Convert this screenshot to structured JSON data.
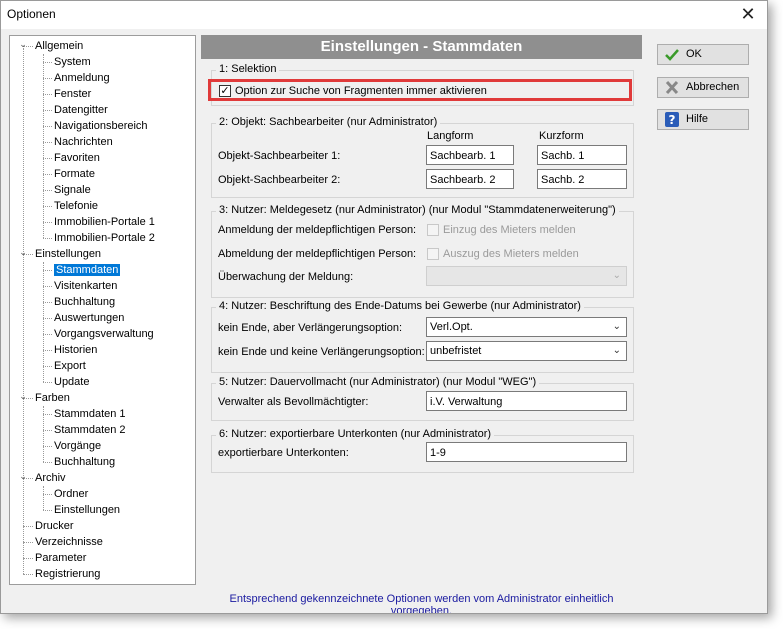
{
  "window": {
    "title": "Optionen",
    "close_glyph": "✕"
  },
  "tree": {
    "nodes": [
      {
        "label": "Allgemein",
        "level": 0,
        "expanded": true
      },
      {
        "label": "System",
        "level": 1
      },
      {
        "label": "Anmeldung",
        "level": 1
      },
      {
        "label": "Fenster",
        "level": 1
      },
      {
        "label": "Datengitter",
        "level": 1
      },
      {
        "label": "Navigationsbereich",
        "level": 1
      },
      {
        "label": "Nachrichten",
        "level": 1
      },
      {
        "label": "Favoriten",
        "level": 1
      },
      {
        "label": "Formate",
        "level": 1
      },
      {
        "label": "Signale",
        "level": 1
      },
      {
        "label": "Telefonie",
        "level": 1
      },
      {
        "label": "Immobilien-Portale 1",
        "level": 1
      },
      {
        "label": "Immobilien-Portale 2",
        "level": 1
      },
      {
        "label": "Einstellungen",
        "level": 0,
        "expanded": true
      },
      {
        "label": "Stammdaten",
        "level": 1,
        "selected": true
      },
      {
        "label": "Visitenkarten",
        "level": 1
      },
      {
        "label": "Buchhaltung",
        "level": 1
      },
      {
        "label": "Auswertungen",
        "level": 1
      },
      {
        "label": "Vorgangsverwaltung",
        "level": 1
      },
      {
        "label": "Historien",
        "level": 1
      },
      {
        "label": "Export",
        "level": 1
      },
      {
        "label": "Update",
        "level": 1
      },
      {
        "label": "Farben",
        "level": 0,
        "expanded": true
      },
      {
        "label": "Stammdaten 1",
        "level": 1
      },
      {
        "label": "Stammdaten 2",
        "level": 1
      },
      {
        "label": "Vorgänge",
        "level": 1
      },
      {
        "label": "Buchhaltung",
        "level": 1
      },
      {
        "label": "Archiv",
        "level": 0,
        "expanded": true
      },
      {
        "label": "Ordner",
        "level": 1
      },
      {
        "label": "Einstellungen",
        "level": 1
      },
      {
        "label": "Drucker",
        "level": 0
      },
      {
        "label": "Verzeichnisse",
        "level": 0
      },
      {
        "label": "Parameter",
        "level": 0
      },
      {
        "label": "Registrierung",
        "level": 0
      }
    ]
  },
  "panel": {
    "banner": "Einstellungen - Stammdaten",
    "g1": {
      "title": "1: Selektion",
      "checkbox_label": "Option zur Suche von Fragmenten immer aktivieren",
      "checked": true
    },
    "g2": {
      "title": "2: Objekt: Sachbearbeiter  (nur Administrator)",
      "col_long": "Langform",
      "col_short": "Kurzform",
      "row1_label": "Objekt-Sachbearbeiter 1:",
      "row1_long": "Sachbearb. 1",
      "row1_short": "Sachb. 1",
      "row2_label": "Objekt-Sachbearbeiter 2:",
      "row2_long": "Sachbearb. 2",
      "row2_short": "Sachb. 2"
    },
    "g3": {
      "title": "3: Nutzer: Meldegesetz  (nur Administrator)  (nur Modul \"Stammdatenerweiterung\")",
      "anmeldung_label": "Anmeldung der meldepflichtigen Person:",
      "anmeldung_check": "Einzug des Mieters melden",
      "abmeldung_label": "Abmeldung der meldepflichtigen Person:",
      "abmeldung_check": "Auszug des Mieters melden",
      "ueberwachung_label": "Überwachung der Meldung:",
      "ueberwachung_value": ""
    },
    "g4": {
      "title": "4: Nutzer: Beschriftung des Ende-Datums bei Gewerbe  (nur Administrator)",
      "row1_label": "kein Ende, aber Verlängerungsoption:",
      "row1_value": "Verl.Opt.",
      "row2_label": "kein Ende und keine Verlängerungsoption:",
      "row2_value": "unbefristet"
    },
    "g5": {
      "title": "5: Nutzer: Dauervollmacht  (nur Administrator)  (nur Modul \"WEG\")",
      "label": "Verwalter als Bevollmächtigter:",
      "value": "i.V. Verwaltung"
    },
    "g6": {
      "title": "6: Nutzer: exportierbare Unterkonten  (nur Administrator)",
      "label": "exportierbare Unterkonten:",
      "value": "1-9"
    }
  },
  "buttons": {
    "ok": "OK",
    "cancel": "Abbrechen",
    "help": "Hilfe"
  },
  "footer": "Entsprechend gekennzeichnete Optionen werden vom Administrator einheitlich vorgegeben.",
  "colors": {
    "banner": "#8f8f8f",
    "highlight": "#e03a3a",
    "selection": "#0078d7",
    "footer_text": "#1a1aa0"
  }
}
